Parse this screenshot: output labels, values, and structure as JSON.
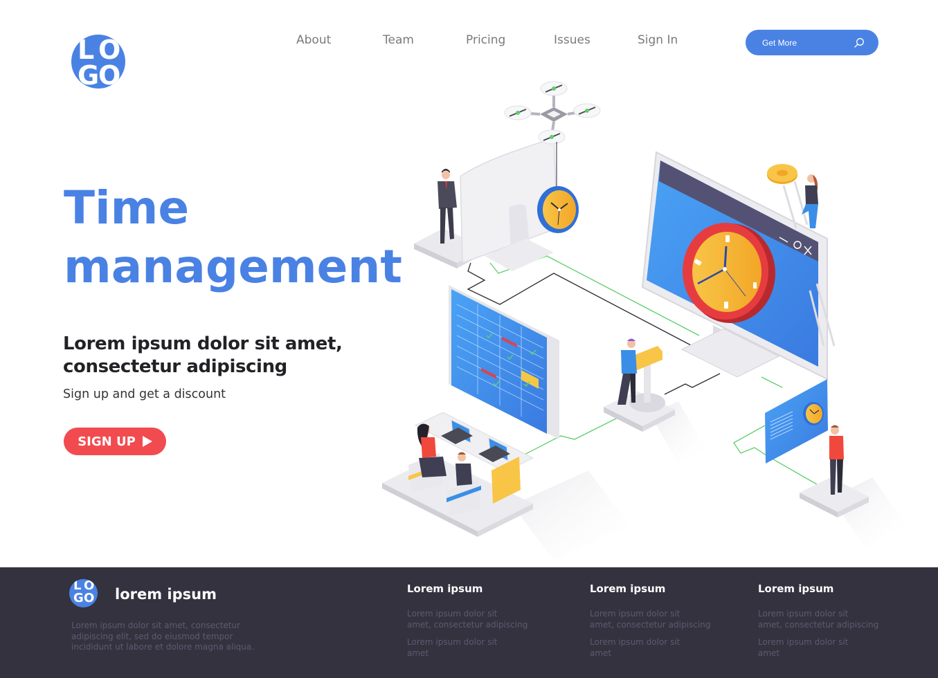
{
  "header": {
    "logo_letters": [
      "L",
      "O",
      "G",
      "O"
    ],
    "nav": [
      {
        "label": "About"
      },
      {
        "label": "Team"
      },
      {
        "label": "Pricing"
      },
      {
        "label": "Issues"
      },
      {
        "label": "Sign In"
      }
    ],
    "search_button": {
      "label": "Get More",
      "icon": "search-icon"
    }
  },
  "hero": {
    "title_line1": "Time",
    "title_line2": "management",
    "subtitle_line1": "Lorem ipsum dolor sit amet,",
    "subtitle_line2": "consectetur adipiscing",
    "tagline": "Sign up and get a discount",
    "cta_label": "SIGN UP",
    "cta_icon": "play-icon"
  },
  "illustration": {
    "description": "Isometric time management scene: drone carrying clock, monitors, people, schedule board, gear",
    "window_controls": [
      "minimize",
      "maximize",
      "close"
    ]
  },
  "colors": {
    "brand_blue": "#4a82e4",
    "cta_red": "#f24b4f",
    "footer_bg": "#34323f",
    "heading_dark": "#222226",
    "nav_gray": "#7a7a7a",
    "connector_green": "#5ccf6a",
    "clock_orange": "#f6b431",
    "clock_red": "#d83236"
  },
  "footer": {
    "logo_letters": [
      "L",
      "O",
      "G",
      "O"
    ],
    "brand": "lorem ipsum",
    "description": "Lorem ipsum dolor sit amet, consectetur adipiscing elit, sed do eiusmod tempor incididunt ut labore et dolore magna aliqua.",
    "columns": [
      {
        "heading": "Lorem ipsum",
        "links": [
          "Lorem ipsum dolor sit\namet, consectetur adipiscing",
          "Lorem ipsum dolor sit\namet"
        ]
      },
      {
        "heading": "Lorem ipsum",
        "links": [
          "Lorem ipsum dolor sit\namet, consectetur adipiscing",
          "Lorem ipsum dolor sit\namet"
        ]
      },
      {
        "heading": "Lorem ipsum",
        "links": [
          "Lorem ipsum dolor sit\namet, consectetur adipiscing",
          "Lorem ipsum dolor sit\namet"
        ]
      }
    ]
  }
}
